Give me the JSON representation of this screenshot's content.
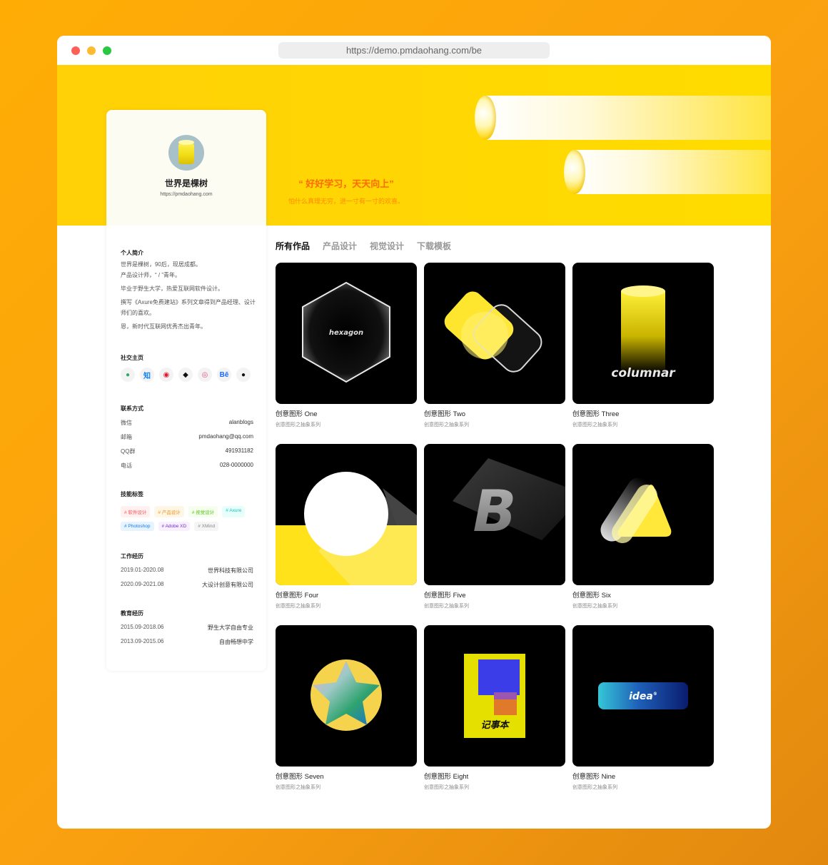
{
  "browser": {
    "url": "https://demo.pmdaohang.com/be"
  },
  "hero": {
    "quote": "“ 好好学习，天天向上”",
    "motto": "怕什么真理无穷，进一寸有一寸的欢喜。"
  },
  "profile": {
    "name": "世界是棵树",
    "site": "https://pmdaohang.com",
    "bio_title": "个人简介",
    "bio": [
      "世界是棵树，90后，现居成都。",
      "产品设计师，“ / ”青年。",
      "毕业于野生大学，热爱互联网软件设计。",
      "撰写《Axure免费建站》系列文章得到产品经理、设计师们的喜欢。",
      "恩，新时代互联网优秀杰出青年。"
    ],
    "social_title": "社交主页",
    "socials": [
      {
        "icon": "wechat-icon",
        "glyph": "●",
        "color": "#2aae67"
      },
      {
        "icon": "zhihu-icon",
        "glyph": "知",
        "color": "#0a7ff5"
      },
      {
        "icon": "weibo-icon",
        "glyph": "◉",
        "color": "#e6162d"
      },
      {
        "icon": "ghost-icon",
        "glyph": "◆",
        "color": "#111111"
      },
      {
        "icon": "dribbble-icon",
        "glyph": "◎",
        "color": "#ea4c89"
      },
      {
        "icon": "behance-icon",
        "glyph": "Bē",
        "color": "#1769ff"
      },
      {
        "icon": "github-icon",
        "glyph": "●",
        "color": "#111111"
      }
    ],
    "contact_title": "联系方式",
    "contacts": [
      {
        "label": "微信",
        "value": "alanblogs"
      },
      {
        "label": "邮箱",
        "value": "pmdaohang@qq.com"
      },
      {
        "label": "QQ群",
        "value": "491931182"
      },
      {
        "label": "电话",
        "value": "028-0000000"
      }
    ],
    "skills_title": "技能标签",
    "skills": [
      {
        "label": "# 软件设计",
        "color": "#ff4d4f",
        "bg": "#fff1f0"
      },
      {
        "label": "# 产品设计",
        "color": "#fa8c16",
        "bg": "#fff7e6"
      },
      {
        "label": "# 视觉设计",
        "color": "#52c41a",
        "bg": "#f6ffed"
      },
      {
        "label": "# Axure",
        "color": "#13c2c2",
        "bg": "#e6fffb"
      },
      {
        "label": "# Photoshop",
        "color": "#1677ff",
        "bg": "#e6f4ff"
      },
      {
        "label": "# Adobe XD",
        "color": "#722ed1",
        "bg": "#f9f0ff"
      },
      {
        "label": "# XMind",
        "color": "#888888",
        "bg": "#f5f5f5"
      }
    ],
    "work_title": "工作经历",
    "work": [
      {
        "period": "2019.01-2020.08",
        "org": "世界科技有限公司"
      },
      {
        "period": "2020.09-2021.08",
        "org": "大设计创意有限公司"
      }
    ],
    "edu_title": "教育经历",
    "edu": [
      {
        "period": "2015.09-2018.06",
        "org": "野生大学自由专业"
      },
      {
        "period": "2013.09-2015.06",
        "org": "自由畅想中学"
      }
    ]
  },
  "tabs": [
    "所有作品",
    "产品设计",
    "视觉设计",
    "下载模板"
  ],
  "works": [
    {
      "title": "创意图形 One",
      "subtitle": "创意图形之抽象系列",
      "art_text": "hexagon"
    },
    {
      "title": "创意图形 Two",
      "subtitle": "创意图形之抽象系列"
    },
    {
      "title": "创意图形 Three",
      "subtitle": "创意图形之抽象系列",
      "art_text": "columnar"
    },
    {
      "title": "创意图形 Four",
      "subtitle": "创意图形之抽象系列"
    },
    {
      "title": "创意图形 Five",
      "subtitle": "创意图形之抽象系列",
      "art_text": "B"
    },
    {
      "title": "创意图形 Six",
      "subtitle": "创意图形之抽象系列"
    },
    {
      "title": "创意图形 Seven",
      "subtitle": "创意图形之抽象系列"
    },
    {
      "title": "创意图形 Eight",
      "subtitle": "创意图形之抽象系列",
      "art_text": "记事本"
    },
    {
      "title": "创意图形 Nine",
      "subtitle": "创意图形之抽象系列",
      "art_text": "idea"
    }
  ]
}
